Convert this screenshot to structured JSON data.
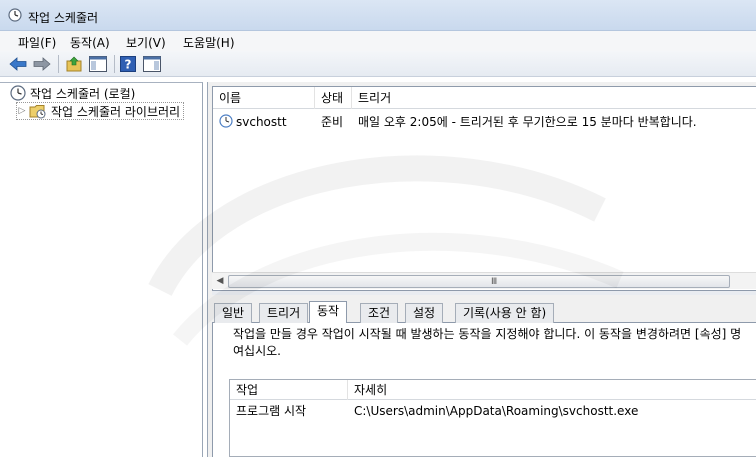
{
  "window": {
    "title": "작업 스케줄러"
  },
  "menu": [
    {
      "label": "파일(F)"
    },
    {
      "label": "동작(A)"
    },
    {
      "label": "보기(V)"
    },
    {
      "label": "도움말(H)"
    }
  ],
  "toolbar": {
    "icons": [
      "back-arrow-icon",
      "forward-arrow-icon",
      "folder-up-icon",
      "show-hide-console-tree-icon",
      "help-icon",
      "show-action-pane-icon"
    ]
  },
  "tree": {
    "root": "작업 스케줄러 (로컬)",
    "library": "작업 스케줄러 라이브러리"
  },
  "tasks": {
    "columns": {
      "name": "이름",
      "status": "상태",
      "trigger": "트리거"
    },
    "rows": [
      {
        "name": "svchostt",
        "status": "준비",
        "trigger": "매일 오후 2:05에 - 트리거된 후 무기한으로 15 분마다 반복합니다."
      }
    ],
    "scroll_grip": "Ⅲ"
  },
  "details": {
    "tabs": [
      "일반",
      "트리거",
      "동작",
      "조건",
      "설정",
      "기록(사용 안 함)"
    ],
    "active_tab": "동작",
    "description_line1": "작업을 만들 경우 작업이 시작될 때 발생하는 동작을 지정해야 합니다. 이 동작을 변경하려면 [속성] 명",
    "description_line2": "여십시오.",
    "actions": {
      "columns": {
        "action": "작업",
        "detail": "자세히"
      },
      "rows": [
        {
          "action": "프로그램 시작",
          "detail": "C:\\Users\\admin\\AppData\\Roaming\\svchostt.exe"
        }
      ]
    }
  },
  "colors": {
    "accent": "#2a5ea8",
    "toolbar_bg": "#e6ebf2",
    "pane_border": "#8e9aab"
  }
}
